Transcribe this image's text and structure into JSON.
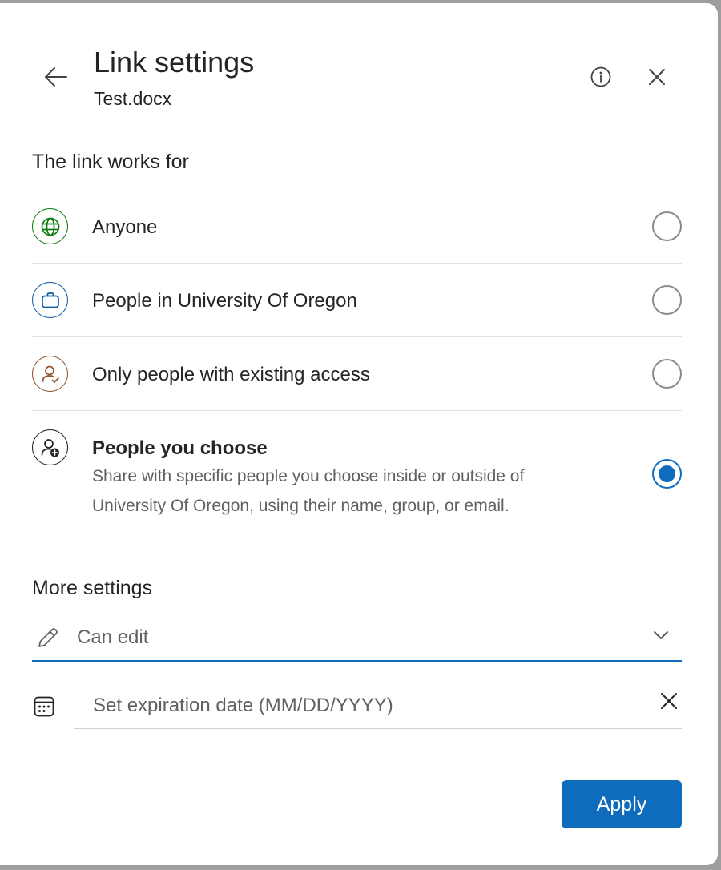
{
  "header": {
    "title": "Link settings",
    "subtitle": "Test.docx",
    "icons": {
      "back": "arrow-left-icon",
      "info": "info-icon",
      "close": "close-icon"
    }
  },
  "audience": {
    "label": "The link works for",
    "options": [
      {
        "label": "Anyone",
        "icon": "globe-icon",
        "color": "#107c10",
        "selected": false
      },
      {
        "label": "People in University Of Oregon",
        "icon": "briefcase-icon",
        "color": "#115ea3",
        "selected": false
      },
      {
        "label": "Only people with existing access",
        "icon": "person-check-icon",
        "color": "#8e562e",
        "selected": false
      },
      {
        "label": "People you choose",
        "description": "Share with specific people you choose inside or outside of University Of Oregon, using their name, group, or email.",
        "icon": "person-add-icon",
        "color": "#242424",
        "selected": true
      }
    ]
  },
  "more_settings": {
    "label": "More settings",
    "permission": {
      "value": "Can edit",
      "icon": "pencil-icon"
    },
    "expiration": {
      "placeholder": "Set expiration date (MM/DD/YYYY)",
      "value": "",
      "icon": "calendar-icon",
      "clear_icon": "dismiss-icon"
    }
  },
  "footer": {
    "apply_label": "Apply"
  },
  "colors": {
    "accent": "#0f6cbd",
    "text_primary": "#242424",
    "text_secondary": "#616161"
  }
}
